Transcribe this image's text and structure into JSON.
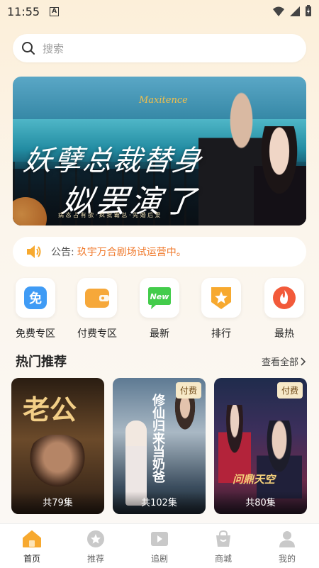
{
  "status_bar": {
    "time": "11:55",
    "a_icon_label": "A"
  },
  "search": {
    "placeholder": "搜索"
  },
  "banner": {
    "title_line1": "妖孽总裁替身",
    "title_line2": "姒罢演了",
    "logo": "Maxitence",
    "caption": "病 态 占 有 欲 · 疯 批 霸 总 · 先 婚 后 爱"
  },
  "notice": {
    "label": "公告:",
    "text": "玖宇万合剧场试运营中。"
  },
  "categories": [
    {
      "label": "免费专区",
      "icon": "free-icon",
      "glyph": "免",
      "color": "#3f9bf5"
    },
    {
      "label": "付费专区",
      "icon": "wallet-icon",
      "glyph": "",
      "color": "#f6a83a"
    },
    {
      "label": "最新",
      "icon": "new-icon",
      "glyph": "New",
      "color": "#43cc4b"
    },
    {
      "label": "排行",
      "icon": "rank-icon",
      "glyph": "★",
      "color": "#f7a92f"
    },
    {
      "label": "最热",
      "icon": "hot-icon",
      "glyph": "",
      "color": "#f25a3a"
    }
  ],
  "section": {
    "title": "热门推荐",
    "see_all": "查看全部"
  },
  "cards": [
    {
      "art_title": "老公",
      "episodes": "共79集",
      "badge": ""
    },
    {
      "art_title": "修仙归来当奶爸",
      "episodes": "共102集",
      "badge": "付费"
    },
    {
      "art_title": "问鼎天空",
      "episodes": "共80集",
      "badge": "付费"
    }
  ],
  "tabbar": [
    {
      "label": "首页",
      "icon": "home-icon",
      "active": true
    },
    {
      "label": "推荐",
      "icon": "star-icon",
      "active": false
    },
    {
      "label": "追剧",
      "icon": "play-icon",
      "active": false
    },
    {
      "label": "商城",
      "icon": "shop-icon",
      "active": false
    },
    {
      "label": "我的",
      "icon": "profile-icon",
      "active": false
    }
  ],
  "colors": {
    "accent": "#f7a92f",
    "notice_text": "#f07a2c",
    "badge_bg": "#f7e9c8"
  }
}
